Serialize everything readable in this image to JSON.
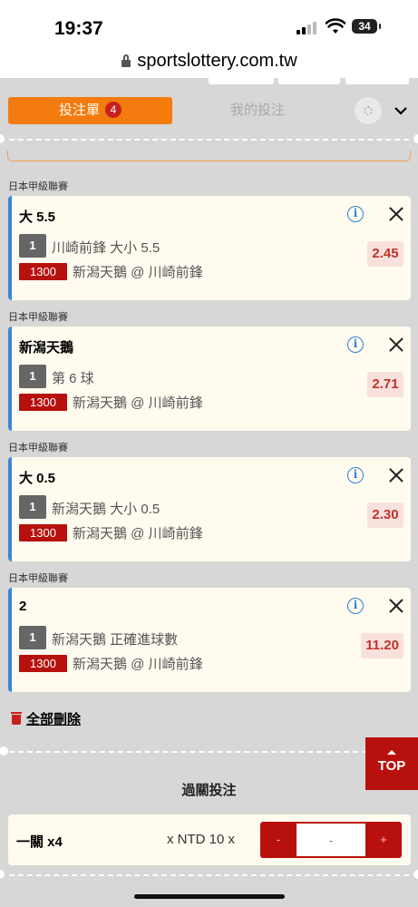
{
  "status_bar": {
    "time": "19:37",
    "battery": "34"
  },
  "url": "sportslottery.com.tw",
  "tabs": {
    "betslip_label": "投注單",
    "betslip_count": "4",
    "my_bets_label": "我的投注"
  },
  "bets": [
    {
      "league": "日本甲級聯賽",
      "title": "大 5.5",
      "leg_number": "1",
      "market": "川崎前鋒 大小 5.5",
      "code": "1300",
      "match": "新潟天鵝 @ 川崎前鋒",
      "odds": "2.45"
    },
    {
      "league": "日本甲級聯賽",
      "title": "新潟天鵝",
      "leg_number": "1",
      "market": "第 6 球",
      "code": "1300",
      "match": "新潟天鵝 @ 川崎前鋒",
      "odds": "2.71"
    },
    {
      "league": "日本甲級聯賽",
      "title": "大 0.5",
      "leg_number": "1",
      "market": "新潟天鵝 大小 0.5",
      "code": "1300",
      "match": "新潟天鵝 @ 川崎前鋒",
      "odds": "2.30"
    },
    {
      "league": "日本甲級聯賽",
      "title": "2",
      "leg_number": "1",
      "market": "新潟天鵝 正確進球數",
      "code": "1300",
      "match": "新潟天鵝 @ 川崎前鋒",
      "odds": "11.20"
    }
  ],
  "info_symbol": "i",
  "delete_all": "全部刪除",
  "top_button": "TOP",
  "parlay": {
    "title": "過關投注",
    "label": "一關 x4",
    "unit": "x NTD 10 x",
    "minus": "-",
    "plus": "+",
    "input_placeholder": "-"
  },
  "colors": {
    "accent_orange": "#f47b0e",
    "brand_red": "#b8110d",
    "card_border_blue": "#3b86d6"
  }
}
